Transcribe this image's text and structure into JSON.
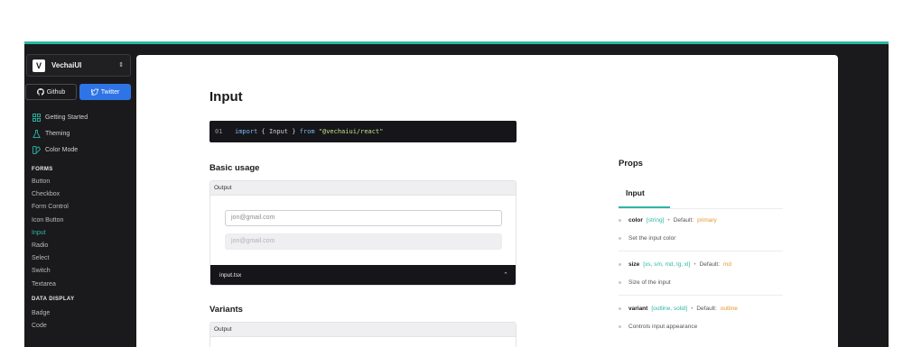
{
  "brand": {
    "logo": "V",
    "name": "VechaiUI",
    "chevron_icon": "chevron-updown-icon"
  },
  "buttons": {
    "github": "Github",
    "twitter": "Twitter"
  },
  "nav_top": [
    {
      "label": "Getting Started",
      "icon": "grid-icon"
    },
    {
      "label": "Theming",
      "icon": "flask-icon"
    },
    {
      "label": "Color Mode",
      "icon": "color-swatch-icon"
    }
  ],
  "sections": {
    "forms": {
      "title": "FORMS",
      "items": [
        "Button",
        "Checkbox",
        "Form Control",
        "Icon Button",
        "Input",
        "Radio",
        "Select",
        "Switch",
        "Textarea"
      ],
      "active": "Input"
    },
    "data_display": {
      "title": "DATA DISPLAY",
      "items": [
        "Badge",
        "Code"
      ]
    }
  },
  "main": {
    "title": "Input",
    "import": {
      "line": "01",
      "kw_import": "import",
      "brace_open": "{",
      "name": "Input",
      "brace_close": "}",
      "kw_from": "from",
      "module": "\"@vechaiui/react\""
    },
    "basic_usage": {
      "heading": "Basic usage",
      "output_label": "Output",
      "input1_placeholder": "jon@gmail.com",
      "input2_placeholder": "jon@gmail.com",
      "file": "input.tsx"
    },
    "variants": {
      "heading": "Variants",
      "output_label": "Output"
    }
  },
  "props": {
    "title": "Props",
    "tab": "Input",
    "items": [
      {
        "name": "color",
        "type": "[string]",
        "sep": "•",
        "default_label": "Default:",
        "default": "primary",
        "desc": "Set the input color"
      },
      {
        "name": "size",
        "type": "[xs, sm, md, lg, xl]",
        "sep": "•",
        "default_label": "Default:",
        "default": "md",
        "desc": "Size of the input"
      },
      {
        "name": "variant",
        "type": "[outline, solid]",
        "sep": "•",
        "default_label": "Default:",
        "default": "outline",
        "desc": "Controls input appearance"
      }
    ]
  },
  "colors": {
    "accent": "#2cb6a4",
    "twitter": "#2f74e6",
    "default_value": "#e9962d",
    "dark": "#1a1a1c"
  }
}
